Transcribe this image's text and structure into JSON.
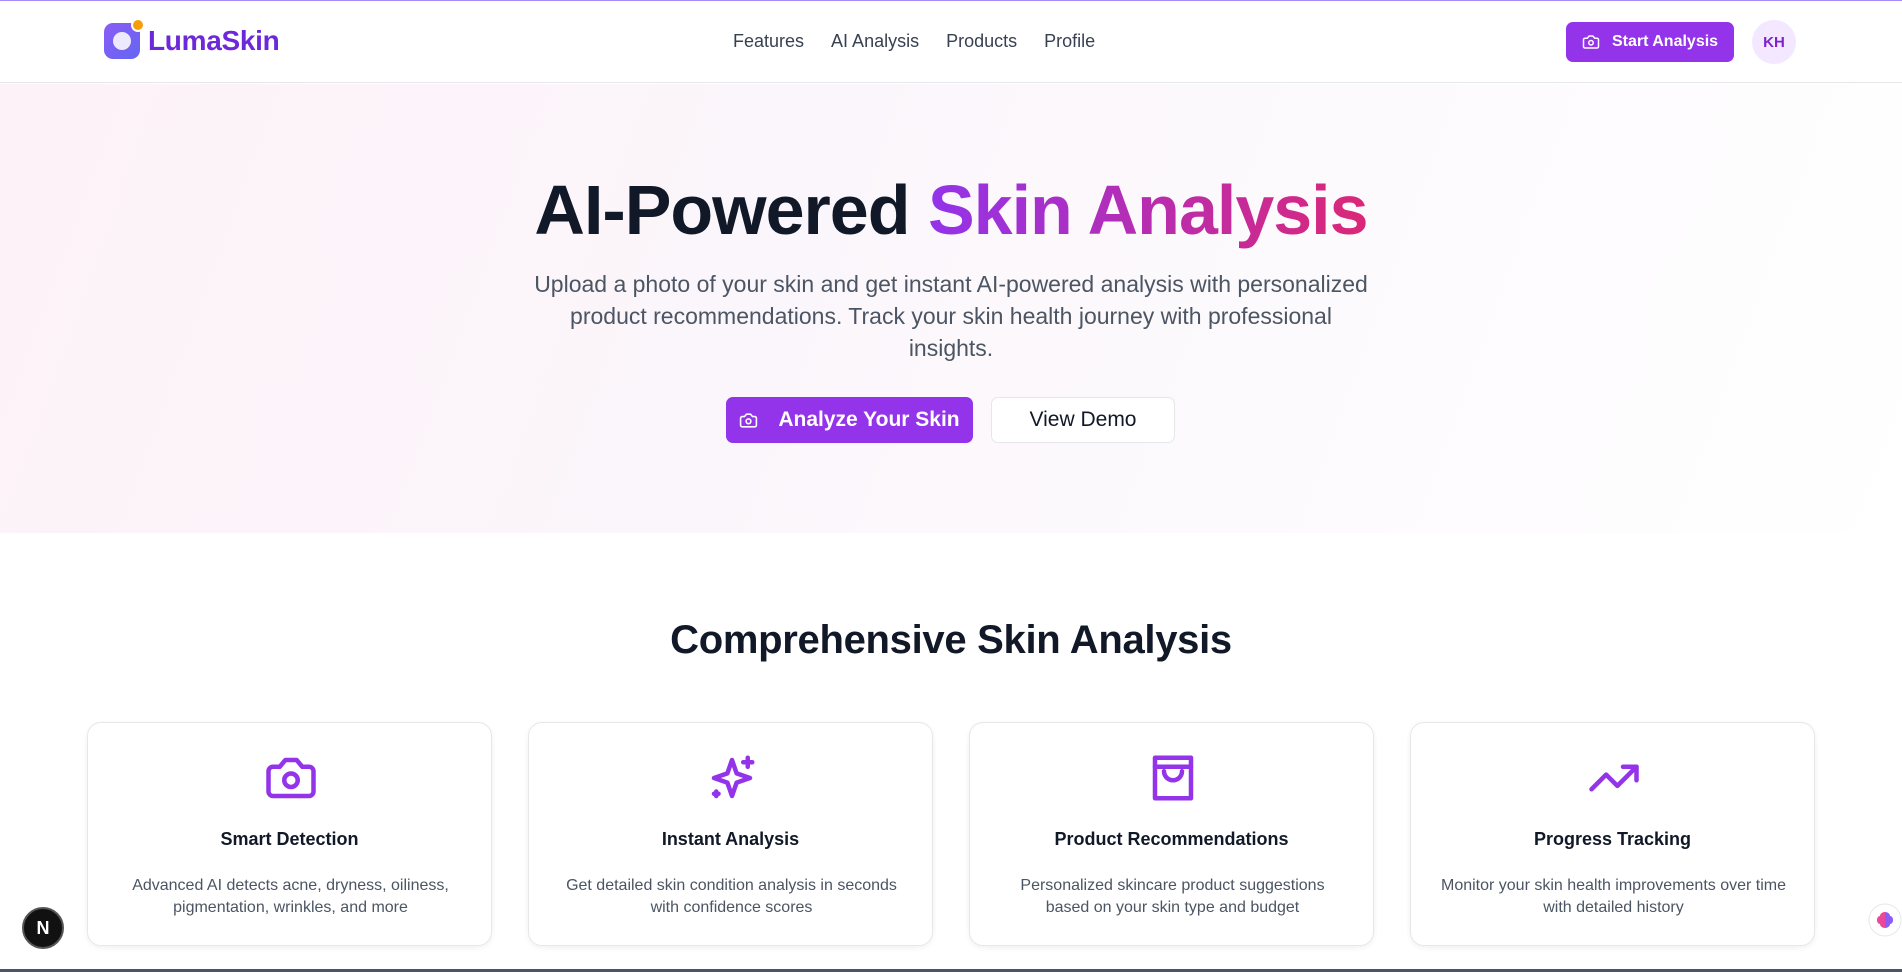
{
  "header": {
    "brand": "LumaSkin",
    "nav": [
      "Features",
      "AI Analysis",
      "Products",
      "Profile"
    ],
    "start_button": "Start Analysis",
    "avatar_initials": "KH"
  },
  "hero": {
    "title_plain": "AI-Powered ",
    "title_highlight": "Skin Analysis",
    "subtitle": "Upload a photo of your skin and get instant AI-powered analysis with personalized product recommendations. Track your skin health journey with professional insights.",
    "primary_cta": "Analyze Your Skin",
    "secondary_cta": "View Demo"
  },
  "features": {
    "title": "Comprehensive Skin Analysis",
    "cards": [
      {
        "icon": "camera-icon",
        "title": "Smart Detection",
        "desc": "Advanced AI detects acne, dryness, oiliness, pigmentation, wrinkles, and more"
      },
      {
        "icon": "sparkles-icon",
        "title": "Instant Analysis",
        "desc": "Get detailed skin condition analysis in seconds with confidence scores"
      },
      {
        "icon": "shopping-bag-icon",
        "title": "Product Recommendations",
        "desc": "Personalized skincare product suggestions based on your skin type and budget"
      },
      {
        "icon": "trending-up-icon",
        "title": "Progress Tracking",
        "desc": "Monitor your skin health improvements over time with detailed history"
      }
    ]
  },
  "overlay": {
    "dev_badge": "N"
  },
  "colors": {
    "accent": "#9333ea",
    "accent_end": "#db2777",
    "text": "#111827",
    "muted": "#4b5563"
  }
}
